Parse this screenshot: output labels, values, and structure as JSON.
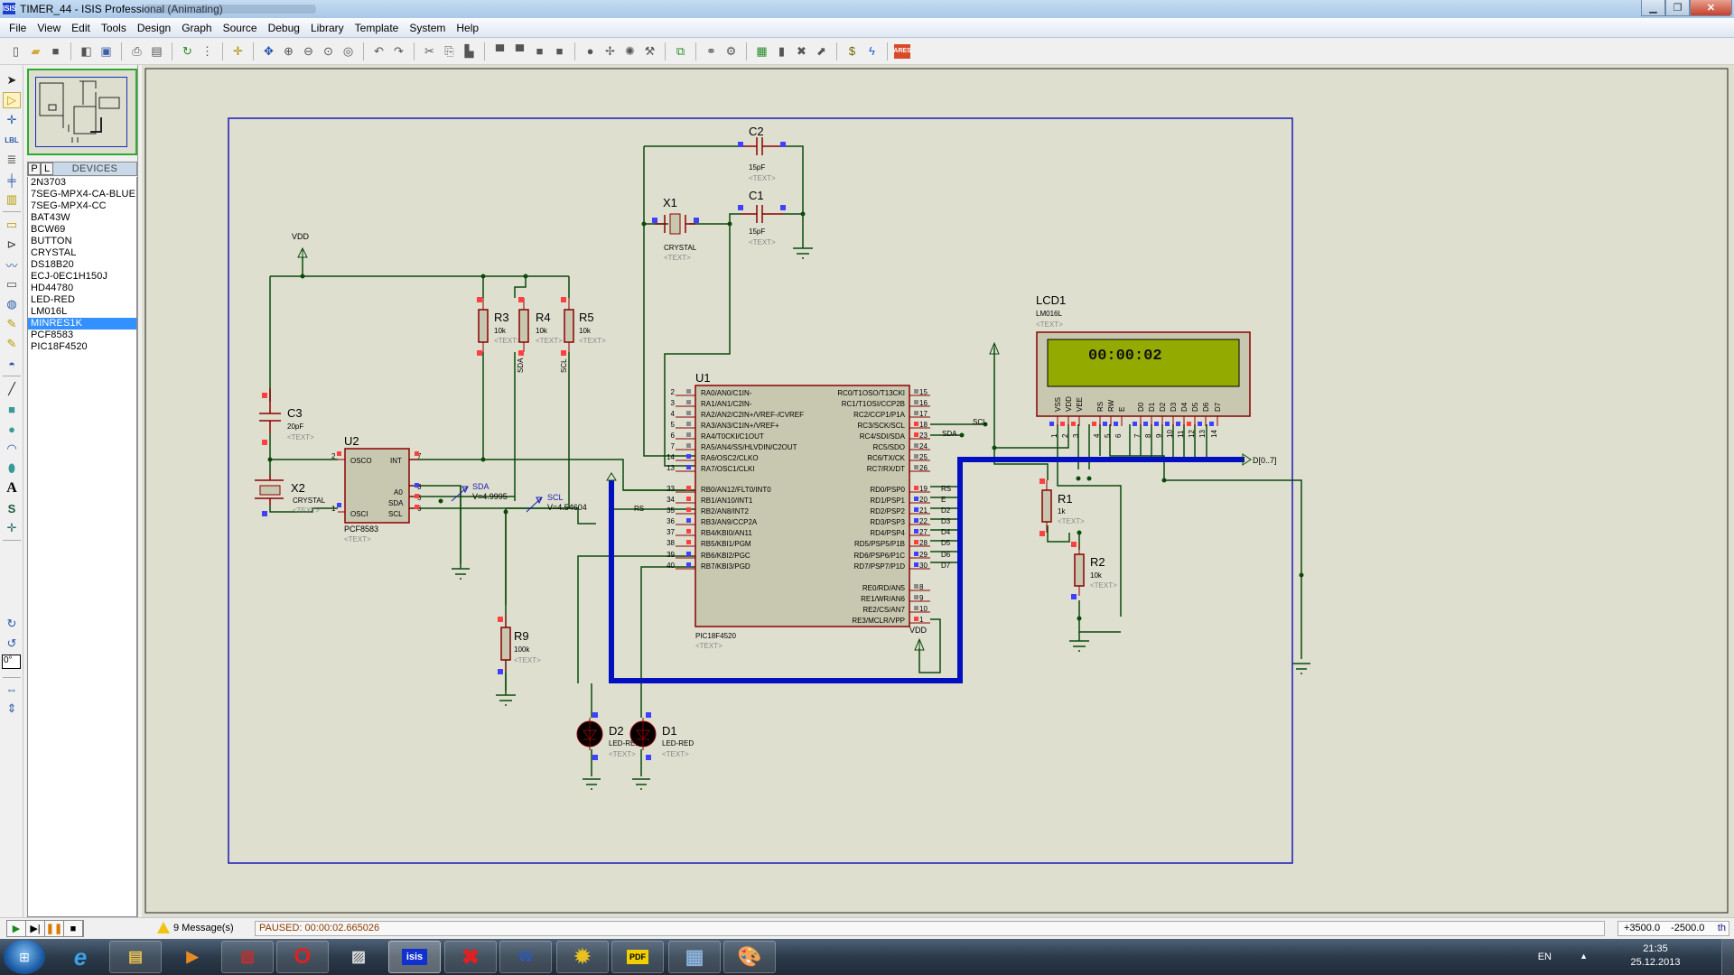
{
  "window": {
    "title": "TIMER_44 - ISIS Professional (Animating)",
    "app_icon": "isis-icon",
    "controls": [
      "minimize",
      "restore",
      "close"
    ]
  },
  "menu": [
    "File",
    "View",
    "Edit",
    "Tools",
    "Design",
    "Graph",
    "Source",
    "Debug",
    "Library",
    "Template",
    "System",
    "Help"
  ],
  "toolbar": {
    "icons": [
      "new-icon",
      "open-icon",
      "save-icon",
      "import-icon",
      "export-icon",
      "print-icon",
      "print-area-icon",
      "redraw-icon",
      "grid-icon",
      "origin-icon",
      "pan-icon",
      "zoom-in-icon",
      "zoom-out-icon",
      "zoom-all-icon",
      "zoom-area-icon",
      "undo-icon",
      "redo-icon",
      "cut-icon",
      "copy-icon",
      "paste-icon",
      "block-copy-icon",
      "block-move-icon",
      "block-rotate-icon",
      "block-delete-icon",
      "pick-device-icon",
      "make-device-icon",
      "packaging-tool-icon",
      "decompose-icon",
      "wire-autorouter-icon",
      "search-tag-icon",
      "property-tool-icon",
      "design-explorer-icon",
      "new-sheet-icon",
      "remove-sheet-icon",
      "go-to-sheet-icon",
      "bill-of-materials-icon",
      "electrical-rule-check-icon",
      "ares-netlist-icon"
    ],
    "ares_label": "ARES"
  },
  "left_tools": {
    "icons": [
      "selection-mode-icon",
      "component-mode-icon",
      "junction-dot-icon",
      "wire-label-icon",
      "text-script-icon",
      "buses-icon",
      "subcircuit-icon",
      "terminals-icon",
      "device-pins-icon",
      "graph-icon",
      "tape-recorder-icon",
      "generator-icon",
      "voltage-probe-icon",
      "current-probe-icon",
      "virtual-instruments-icon",
      "line-icon",
      "box-icon",
      "circle-icon",
      "arc-icon",
      "closed-path-icon",
      "text-icon",
      "symbol-icon",
      "marker-icon",
      "rotate-clockwise-icon",
      "rotate-anticlockwise-icon",
      "mirror-x-icon",
      "mirror-y-icon"
    ],
    "wire_label_text": "LBL",
    "rotation_value": "0°"
  },
  "devices_panel": {
    "tab_p": "P",
    "tab_l": "L",
    "header": "DEVICES",
    "items": [
      "2N3703",
      "7SEG-MPX4-CA-BLUE",
      "7SEG-MPX4-CC",
      "BAT43W",
      "BCW69",
      "BUTTON",
      "CRYSTAL",
      "DS18B20",
      "ECJ-0EC1H150J",
      "HD44780",
      "LED-RED",
      "LM016L",
      "MINRES1K",
      "PCF8583",
      "PIC18F4520"
    ],
    "selected": "MINRES1K"
  },
  "schematic": {
    "u1": {
      "ref": "U1",
      "part": "PIC18F4520",
      "text": "<TEXT>",
      "left_pins": [
        {
          "num": "2",
          "name": "RA0/AN0/C1IN-",
          "state": "grey"
        },
        {
          "num": "3",
          "name": "RA1/AN1/C2IN-",
          "state": "grey"
        },
        {
          "num": "4",
          "name": "RA2/AN2/C2IN+/VREF-/CVREF",
          "state": "grey"
        },
        {
          "num": "5",
          "name": "RA3/AN3/C1IN+/VREF+",
          "state": "grey"
        },
        {
          "num": "6",
          "name": "RA4/T0CKI/C1OUT",
          "state": "grey"
        },
        {
          "num": "7",
          "name": "RA5/AN4/SS/HLVDIN/C2OUT",
          "state": "grey"
        },
        {
          "num": "14",
          "name": "RA6/OSC2/CLKO",
          "state": "blue"
        },
        {
          "num": "13",
          "name": "RA7/OSC1/CLKI",
          "state": "blue"
        },
        {
          "num": "33",
          "name": "RB0/AN12/FLT0/INT0",
          "state": "red"
        },
        {
          "num": "34",
          "name": "RB1/AN10/INT1",
          "state": "red"
        },
        {
          "num": "35",
          "name": "RB2/AN8/INT2",
          "state": "red"
        },
        {
          "num": "36",
          "name": "RB3/AN9/CCP2A",
          "state": "blue"
        },
        {
          "num": "37",
          "name": "RB4/KBI0/AN11",
          "state": "red"
        },
        {
          "num": "38",
          "name": "RB5/KBI1/PGM",
          "state": "red"
        },
        {
          "num": "39",
          "name": "RB6/KBI2/PGC",
          "state": "blue"
        },
        {
          "num": "40",
          "name": "RB7/KBI3/PGD",
          "state": "blue"
        }
      ],
      "right_pins": [
        {
          "num": "15",
          "name": "RC0/T1OSO/T13CKI",
          "state": "grey",
          "net": ""
        },
        {
          "num": "16",
          "name": "RC1/T1OSI/CCP2B",
          "state": "grey",
          "net": ""
        },
        {
          "num": "17",
          "name": "RC2/CCP1/P1A",
          "state": "grey",
          "net": ""
        },
        {
          "num": "18",
          "name": "RC3/SCK/SCL",
          "state": "red",
          "net": "SCL"
        },
        {
          "num": "23",
          "name": "RC4/SDI/SDA",
          "state": "red",
          "net": "SDA"
        },
        {
          "num": "24",
          "name": "RC5/SDO",
          "state": "grey",
          "net": ""
        },
        {
          "num": "25",
          "name": "RC6/TX/CK",
          "state": "grey",
          "net": ""
        },
        {
          "num": "26",
          "name": "RC7/RX/DT",
          "state": "grey",
          "net": ""
        },
        {
          "num": "19",
          "name": "RD0/PSP0",
          "state": "red",
          "net": "RS"
        },
        {
          "num": "20",
          "name": "RD1/PSP1",
          "state": "blue",
          "net": "E"
        },
        {
          "num": "21",
          "name": "RD2/PSP2",
          "state": "blue",
          "net": "D2"
        },
        {
          "num": "22",
          "name": "RD3/PSP3",
          "state": "blue",
          "net": "D3"
        },
        {
          "num": "27",
          "name": "RD4/PSP4",
          "state": "blue",
          "net": "D4"
        },
        {
          "num": "28",
          "name": "RD5/PSP5/P1B",
          "state": "red",
          "net": "D5"
        },
        {
          "num": "29",
          "name": "RD6/PSP6/P1C",
          "state": "blue",
          "net": "D6"
        },
        {
          "num": "30",
          "name": "RD7/PSP7/P1D",
          "state": "blue",
          "net": "D7"
        },
        {
          "num": "8",
          "name": "RE0/RD/AN5",
          "state": "grey",
          "net": ""
        },
        {
          "num": "9",
          "name": "RE1/WR/AN6",
          "state": "grey",
          "net": ""
        },
        {
          "num": "10",
          "name": "RE2/CS/AN7",
          "state": "grey",
          "net": ""
        },
        {
          "num": "1",
          "name": "RE3/MCLR/VPP",
          "state": "red",
          "net": ""
        }
      ],
      "rs_net": "RS"
    },
    "u2": {
      "ref": "U2",
      "part": "PCF8583",
      "text": "<TEXT>",
      "pins": {
        "osco": "OSCO",
        "int": "INT",
        "a0": "A0",
        "sda": "SDA",
        "osci": "OSCI",
        "scl": "SCL"
      },
      "pin_nums": {
        "osco": "2",
        "int": "7",
        "a0": "3",
        "sda": "5",
        "scl": "6",
        "osci": "1"
      }
    },
    "lcd": {
      "ref": "LCD1",
      "part": "LM016L",
      "text": "<TEXT>",
      "display_line1": "00:00:02",
      "display_line2": "",
      "pin_names": [
        "VSS",
        "VDD",
        "VEE",
        "RS",
        "RW",
        "E",
        "D0",
        "D1",
        "D2",
        "D3",
        "D4",
        "D5",
        "D6",
        "D7"
      ],
      "pin_nums": [
        "1",
        "2",
        "3",
        "4",
        "5",
        "6",
        "7",
        "8",
        "9",
        "10",
        "11",
        "12",
        "13",
        "14"
      ],
      "pin_states": [
        "blue",
        "red",
        "red",
        "red",
        "blue",
        "blue",
        "blue",
        "blue",
        "blue",
        "blue",
        "blue",
        "red",
        "blue",
        "blue"
      ],
      "net_labels": [
        "RS",
        "E",
        "D4",
        "D5",
        "D6",
        "D7"
      ]
    },
    "bus_label": "D[0..7]",
    "components": [
      {
        "ref": "R3",
        "value": "10k",
        "text": "<TEXT>"
      },
      {
        "ref": "R4",
        "value": "10k",
        "text": "<TEXT>",
        "net": "SDA"
      },
      {
        "ref": "R5",
        "value": "10k",
        "text": "<TEXT>",
        "net": "SCL"
      },
      {
        "ref": "R9",
        "value": "100k",
        "text": "<TEXT>"
      },
      {
        "ref": "R1",
        "value": "1k",
        "text": "<TEXT>"
      },
      {
        "ref": "R2",
        "value": "10k",
        "text": "<TEXT>"
      },
      {
        "ref": "C1",
        "value": "15pF",
        "text": "<TEXT>"
      },
      {
        "ref": "C2",
        "value": "15pF",
        "text": "<TEXT>"
      },
      {
        "ref": "C3",
        "value": "20pF",
        "text": "<TEXT>"
      },
      {
        "ref": "X1",
        "value": "CRYSTAL",
        "text": "<TEXT>"
      },
      {
        "ref": "X2",
        "value": "CRYSTAL",
        "text": "<TEXT>"
      },
      {
        "ref": "D1",
        "value": "LED-RED",
        "text": "<TEXT>"
      },
      {
        "ref": "D2",
        "value": "LED-RED",
        "text": "<TEXT>"
      }
    ],
    "probes": [
      {
        "name": "SDA",
        "reading": "V=4.9995"
      },
      {
        "name": "SCL",
        "reading": "V=4.54604"
      }
    ],
    "power_labels": {
      "vdd": "VDD",
      "u1_vdd": "VDD"
    },
    "colors": {
      "canvas": "#dfdfd0",
      "wire": "#0a4a0a",
      "pin": "#8b0000",
      "body": "#c8c8b0",
      "bus": "#0010c0",
      "sheet_border": "#1a1ab8",
      "pin_red": "#ff4040",
      "pin_blue": "#4040ff",
      "pin_grey": "#8a8a8a",
      "lcd_screen": "#93ab00"
    }
  },
  "status": {
    "sim_buttons": [
      "play-icon",
      "step-icon",
      "pause-icon",
      "stop-icon"
    ],
    "messages": "9 Message(s)",
    "state": "PAUSED: 00:00:02.665026",
    "x": "+3500.0",
    "y": "-2500.0",
    "unit": "th"
  },
  "taskbar": {
    "apps": [
      "Internet Explorer",
      "Windows Explorer",
      "Media Player",
      "Save",
      "Opera",
      "Scanner",
      "ISIS",
      "MPLAB",
      "Word",
      "Imagine",
      "PDF",
      "Calculator",
      "Paint"
    ],
    "isis_label": "isis",
    "language": "EN",
    "time": "21:35",
    "date": "25.12.2013"
  }
}
